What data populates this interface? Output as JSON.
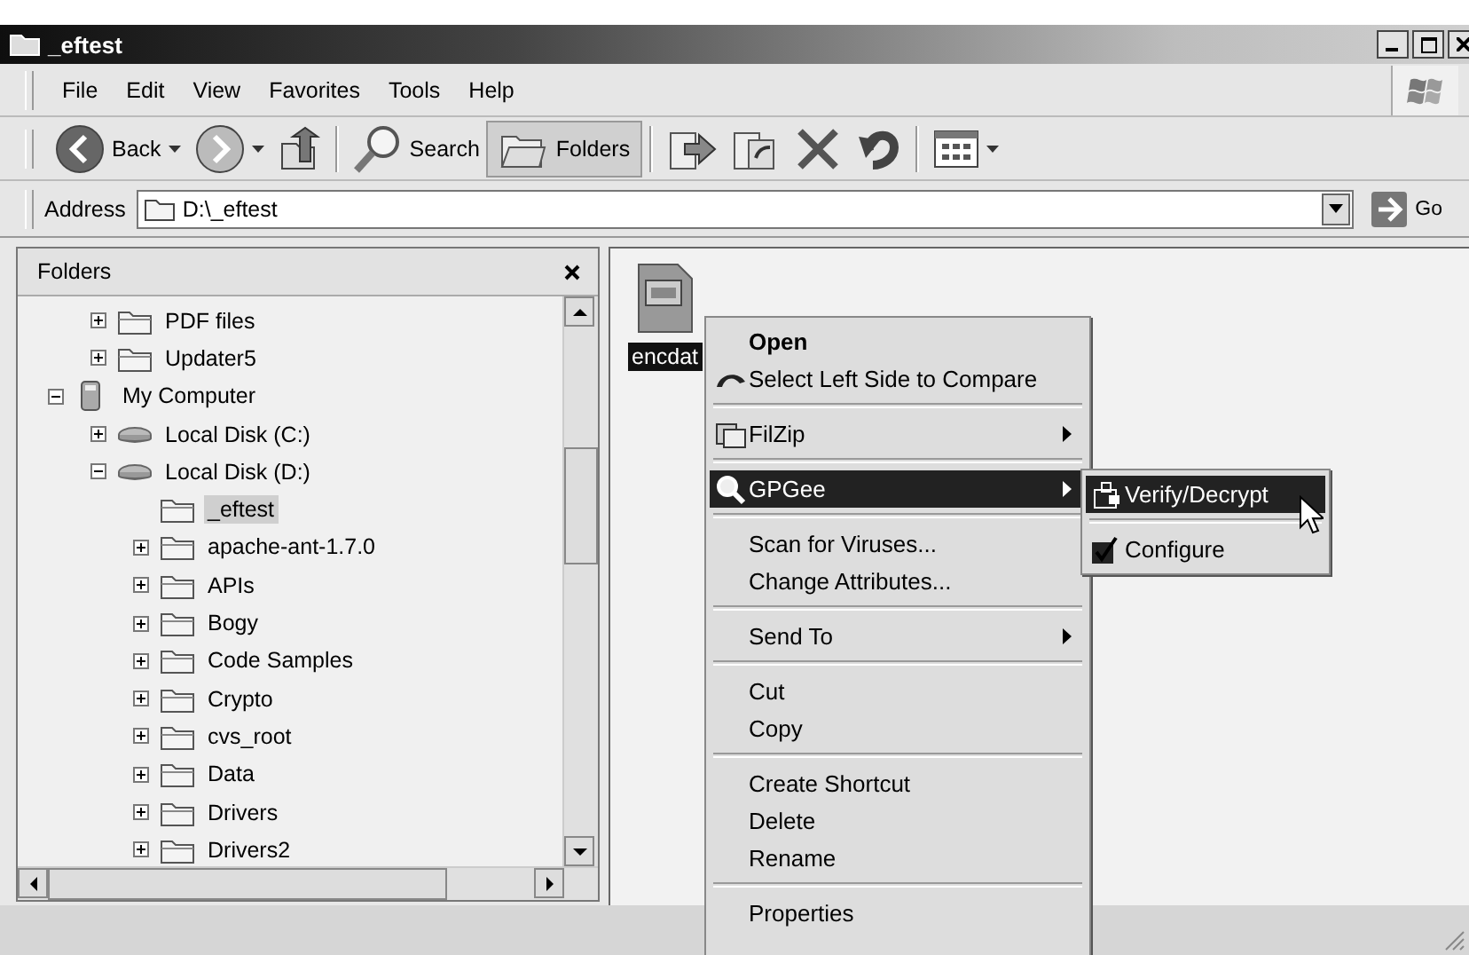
{
  "window": {
    "title": "_eftest"
  },
  "menu_bar": [
    "File",
    "Edit",
    "View",
    "Favorites",
    "Tools",
    "Help"
  ],
  "toolbar": [
    {
      "kind": "back",
      "label": "Back",
      "disabled": false
    },
    {
      "kind": "forward",
      "disabled": true
    },
    {
      "kind": "up"
    },
    {
      "kind": "separator"
    },
    {
      "kind": "search",
      "label": "Search",
      "pressed": false
    },
    {
      "kind": "folders",
      "label": "Folders",
      "pressed": true
    },
    {
      "kind": "separator"
    },
    {
      "kind": "move"
    },
    {
      "kind": "copy"
    },
    {
      "kind": "delete"
    },
    {
      "kind": "undo"
    },
    {
      "kind": "separator"
    },
    {
      "kind": "views"
    }
  ],
  "address_bar": {
    "label": "Address",
    "value": "D:\\_eftest",
    "go": "Go"
  },
  "folders_pane": {
    "title": "Folders",
    "tree": [
      {
        "kind": "scrolled-out",
        "children": [
          {
            "kind": "folder",
            "label": "PDF files",
            "expanded": false,
            "selected": false
          },
          {
            "kind": "folder",
            "label": "Updater5",
            "expanded": false,
            "selected": false
          }
        ]
      },
      {
        "kind": "computer",
        "label": "My Computer",
        "expanded": true,
        "selected": false,
        "children": [
          {
            "kind": "drive",
            "label": "Local Disk (C:)",
            "expanded": false,
            "selected": false
          },
          {
            "kind": "drive",
            "label": "Local Disk (D:)",
            "expanded": true,
            "selected": false,
            "children": [
              {
                "kind": "folder",
                "label": "_eftest",
                "selected": true
              },
              {
                "kind": "folder",
                "label": "apache-ant-1.7.0",
                "expanded": false,
                "selected": false
              },
              {
                "kind": "folder",
                "label": "APIs",
                "expanded": false,
                "selected": false
              },
              {
                "kind": "folder",
                "label": "Bogy",
                "expanded": false,
                "selected": false
              },
              {
                "kind": "folder",
                "label": "Code Samples",
                "expanded": false,
                "selected": false
              },
              {
                "kind": "folder",
                "label": "Crypto",
                "expanded": false,
                "selected": false
              },
              {
                "kind": "folder",
                "label": "cvs_root",
                "expanded": false,
                "selected": false
              },
              {
                "kind": "folder",
                "label": "Data",
                "expanded": false,
                "selected": false
              },
              {
                "kind": "folder",
                "label": "Drivers",
                "expanded": false,
                "selected": false
              },
              {
                "kind": "folder",
                "label": "Drivers2",
                "expanded": false,
                "selected": false
              }
            ]
          }
        ]
      }
    ]
  },
  "files": [
    {
      "name": "encdat",
      "selected": true
    }
  ],
  "context_menu": {
    "items": [
      {
        "kind": "plain",
        "label": "Open",
        "default": true,
        "selected": false,
        "submenu": false
      },
      {
        "kind": "compare",
        "label": "Select Left Side to Compare",
        "default": false,
        "selected": false,
        "submenu": false
      },
      {
        "kind": "separator"
      },
      {
        "kind": "archive",
        "label": "FilZip",
        "default": false,
        "selected": false,
        "submenu": true
      },
      {
        "kind": "separator"
      },
      {
        "kind": "magnifier",
        "label": "GPGee",
        "default": false,
        "selected": true,
        "submenu": true
      },
      {
        "kind": "separator"
      },
      {
        "kind": "plain",
        "label": "Scan for Viruses...",
        "default": false,
        "selected": false,
        "submenu": false
      },
      {
        "kind": "plain",
        "label": "Change Attributes...",
        "default": false,
        "selected": false,
        "submenu": false
      },
      {
        "kind": "separator"
      },
      {
        "kind": "plain",
        "label": "Send To",
        "default": false,
        "selected": false,
        "submenu": true
      },
      {
        "kind": "separator"
      },
      {
        "kind": "plain",
        "label": "Cut",
        "default": false,
        "selected": false,
        "submenu": false
      },
      {
        "kind": "plain",
        "label": "Copy",
        "default": false,
        "selected": false,
        "submenu": false
      },
      {
        "kind": "separator"
      },
      {
        "kind": "plain",
        "label": "Create Shortcut",
        "default": false,
        "selected": false,
        "submenu": false
      },
      {
        "kind": "plain",
        "label": "Delete",
        "default": false,
        "selected": false,
        "submenu": false
      },
      {
        "kind": "plain",
        "label": "Rename",
        "default": false,
        "selected": false,
        "submenu": false
      },
      {
        "kind": "separator"
      },
      {
        "kind": "plain",
        "label": "Properties",
        "default": false,
        "selected": false,
        "submenu": false
      }
    ]
  },
  "submenu": {
    "items": [
      {
        "kind": "unlock",
        "label": "Verify/Decrypt",
        "selected": true
      },
      {
        "kind": "separator"
      },
      {
        "kind": "check",
        "label": "Configure",
        "selected": false
      }
    ]
  }
}
